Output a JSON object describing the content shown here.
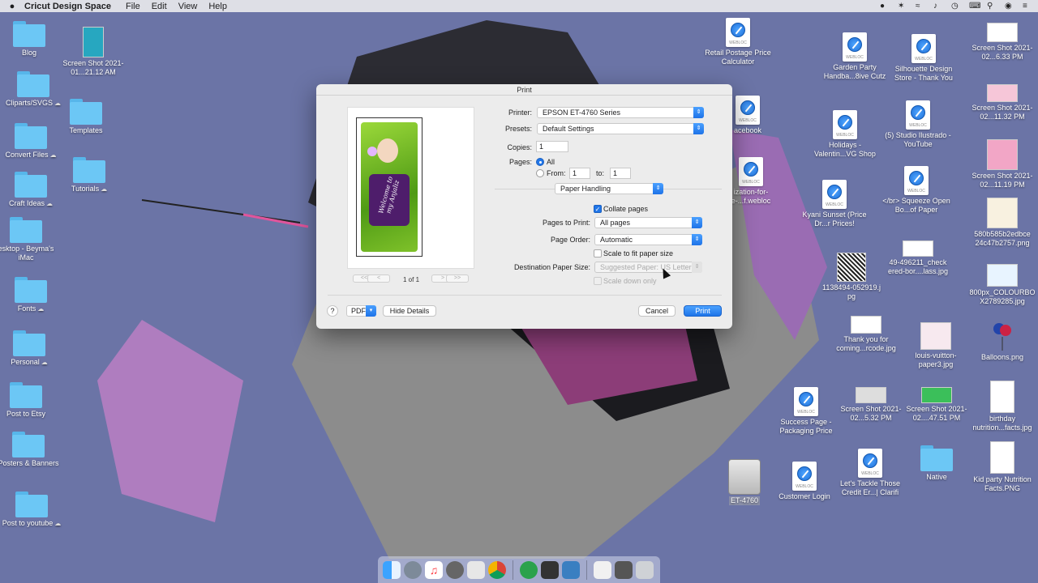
{
  "menubar": {
    "app_name": "Cricut Design Space",
    "menus": [
      "File",
      "Edit",
      "View",
      "Help"
    ]
  },
  "desktop_left": [
    {
      "label": "Blog",
      "type": "folder",
      "cloud": false
    },
    {
      "label": "Screen Shot 2021-01...21.12 AM",
      "type": "thumb",
      "cloud": false
    },
    {
      "label": "Cliparts/SVGS",
      "type": "folder",
      "cloud": true
    },
    {
      "label": "Templates",
      "type": "folder",
      "cloud": false
    },
    {
      "label": "Convert Files",
      "type": "folder",
      "cloud": true
    },
    {
      "label": "Tutorials",
      "type": "folder",
      "cloud": true
    },
    {
      "label": "Craft Ideas",
      "type": "folder",
      "cloud": true
    },
    {
      "label": "esktop - Beyma's iMac",
      "type": "folder",
      "cloud": false
    },
    {
      "label": "Fonts",
      "type": "folder",
      "cloud": true
    },
    {
      "label": "Personal",
      "type": "folder",
      "cloud": true
    },
    {
      "label": "Post to Etsy",
      "type": "folder",
      "cloud": false
    },
    {
      "label": "Posters & Banners",
      "type": "folder",
      "cloud": false
    },
    {
      "label": "Post to youtube",
      "type": "folder",
      "cloud": true
    }
  ],
  "desktop_right": [
    {
      "label": "Retail Postage Price Calculator",
      "type": "webloc"
    },
    {
      "label": "acebook",
      "type": "webloc"
    },
    {
      "label": "ization-for-e-...f.webloc",
      "type": "webloc"
    },
    {
      "label": "Garden Party Handba...8ive Cutz",
      "type": "webloc"
    },
    {
      "label": "Silhouette Design Store - Thank You",
      "type": "webloc"
    },
    {
      "label": "Screen Shot 2021-02...6.33 PM",
      "type": "thumb"
    },
    {
      "label": "Holidays - Valentin...VG Shop",
      "type": "webloc"
    },
    {
      "label": "(5) Studio Ilustrado - YouTube",
      "type": "webloc"
    },
    {
      "label": "Screen Shot 2021-02...11.32 PM",
      "type": "thumb"
    },
    {
      "label": "Screen Shot 2021-02...11.19 PM",
      "type": "thumb"
    },
    {
      "label": "Kyani Sunset (Price Dr...r Prices!",
      "type": "webloc"
    },
    {
      "label": "</br> Squeeze Open Bo...of Paper",
      "type": "webloc"
    },
    {
      "label": "580b585b2edbce 24c47b2757.png",
      "type": "thumb"
    },
    {
      "label": "1138494-052919.j pg",
      "type": "thumb"
    },
    {
      "label": "49-496211_check ered-bor....lass.jpg",
      "type": "thumb"
    },
    {
      "label": "800px_COLOURBO X2789285.jpg",
      "type": "thumb"
    },
    {
      "label": "Thank you for coming...rcode.jpg",
      "type": "thumb"
    },
    {
      "label": "louis-vuitton-paper3.jpg",
      "type": "thumb"
    },
    {
      "label": "Balloons.png",
      "type": "thumb"
    },
    {
      "label": "Success Page - Packaging Price",
      "type": "webloc"
    },
    {
      "label": "Screen Shot 2021-02...5.32 PM",
      "type": "thumb"
    },
    {
      "label": "Screen Shot 2021-02....47.51 PM",
      "type": "thumb"
    },
    {
      "label": "birthday nutrition...facts.jpg",
      "type": "thumb"
    },
    {
      "label": "ET-4760",
      "type": "disk"
    },
    {
      "label": "Customer Login",
      "type": "webloc"
    },
    {
      "label": "Let's Tackle Those Credit Er...| Clarifi",
      "type": "webloc"
    },
    {
      "label": "Native",
      "type": "folder"
    },
    {
      "label": "Kid party Nutrition Facts.PNG",
      "type": "thumb"
    }
  ],
  "print_dialog": {
    "title": "Print",
    "preview_text": "Welcome to my Anjaliz",
    "page_indicator": "1 of 1",
    "first_label": "<<",
    "prev_label": "<",
    "next_label": ">",
    "last_label": ">>",
    "printer_label": "Printer:",
    "printer_value": "EPSON ET-4760 Series",
    "presets_label": "Presets:",
    "presets_value": "Default Settings",
    "copies_label": "Copies:",
    "copies_value": "1",
    "pages_label": "Pages:",
    "pages_all": "All",
    "pages_from": "From:",
    "from_value": "1",
    "to_label": "to:",
    "to_value": "1",
    "section_value": "Paper Handling",
    "collate_label": "Collate pages",
    "pages_to_print_label": "Pages to Print:",
    "pages_to_print_value": "All pages",
    "page_order_label": "Page Order:",
    "page_order_value": "Automatic",
    "scale_label": "Scale to fit paper size",
    "dest_label": "Destination Paper Size:",
    "dest_value": "Suggested Paper: US Letter",
    "scale_down_label": "Scale down only",
    "help_label": "?",
    "pdf_label": "PDF",
    "hide_details_label": "Hide Details",
    "cancel_label": "Cancel",
    "print_label": "Print"
  },
  "dock_apps": [
    "finder-icon",
    "launchpad-icon",
    "music-icon",
    "system-prefs-icon",
    "preview-icon",
    "chrome-icon",
    "cricut-icon",
    "silhouette-icon",
    "photos-icon",
    "downloads-icon",
    "documents-icon",
    "trash-icon"
  ]
}
